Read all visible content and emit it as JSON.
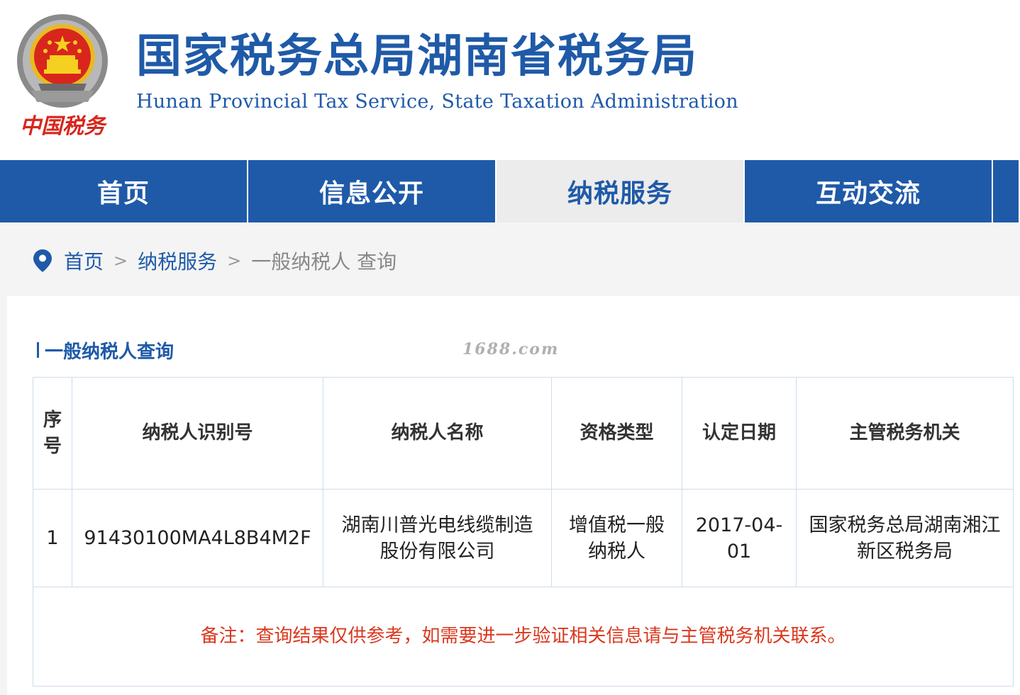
{
  "header": {
    "emblem_label": "中国税务",
    "title_cn": "国家税务总局湖南省税务局",
    "title_en": "Hunan Provincial  Tax Service,  State Taxation Administration"
  },
  "nav": {
    "items": [
      {
        "label": "首页",
        "active": false
      },
      {
        "label": "信息公开",
        "active": false
      },
      {
        "label": "纳税服务",
        "active": true
      },
      {
        "label": "互动交流",
        "active": false
      }
    ]
  },
  "breadcrumb": {
    "items": [
      {
        "label": "首页"
      },
      {
        "label": "纳税服务"
      }
    ],
    "current": "一般纳税人 查询",
    "separator": ">"
  },
  "section": {
    "title": "一般纳税人查询",
    "watermark": "1688.com"
  },
  "table": {
    "headers": [
      "序号",
      "纳税人识别号",
      "纳税人名称",
      "资格类型",
      "认定日期",
      "主管税务机关"
    ],
    "rows": [
      [
        "1",
        "91430100MA4L8B4M2F",
        "湖南川普光电线缆制造股份有限公司",
        "增值税一般纳税人",
        "2017-04-01",
        "国家税务总局湖南湘江新区税务局"
      ]
    ],
    "note": "备注：查询结果仅供参考，如需要进一步验证相关信息请与主管税务机关联系。"
  },
  "colors": {
    "brand_blue": "#1f5aa8",
    "note_red": "#d9381e",
    "emblem_red": "#d8261c",
    "emblem_gold": "#e8b923"
  }
}
